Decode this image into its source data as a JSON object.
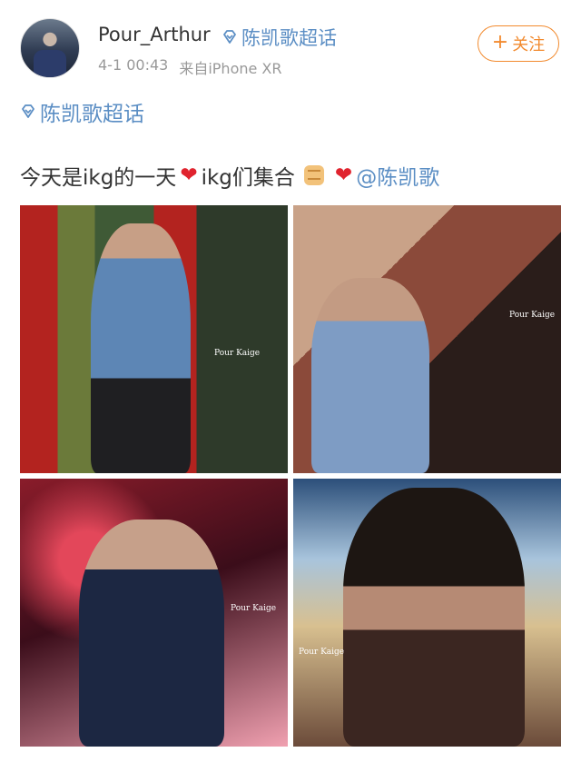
{
  "post": {
    "username": "Pour_Arthur",
    "topic_label": "陈凯歌超话",
    "time": "4-1 00:43",
    "source": "来自iPhone XR",
    "follow_label": "关注",
    "follow_plus": "+",
    "topic_block_label": "陈凯歌超话",
    "text_part1": "今天是ikg的一天",
    "text_part2": "ikg们集合",
    "mention": "@陈凯歌"
  },
  "photos": [
    {
      "watermark": "Pour Kaige"
    },
    {
      "watermark": "Pour Kaige"
    },
    {
      "watermark": "Pour Kaige"
    },
    {
      "watermark": "Pour Kaige"
    }
  ],
  "colors": {
    "link": "#5b8ec4",
    "follow": "#f28a2e",
    "heart": "#e0232e",
    "meta": "#999999"
  },
  "icons": {
    "topic": "diamond-icon",
    "heart": "heart-icon",
    "fist": "fist-emoji-icon"
  }
}
